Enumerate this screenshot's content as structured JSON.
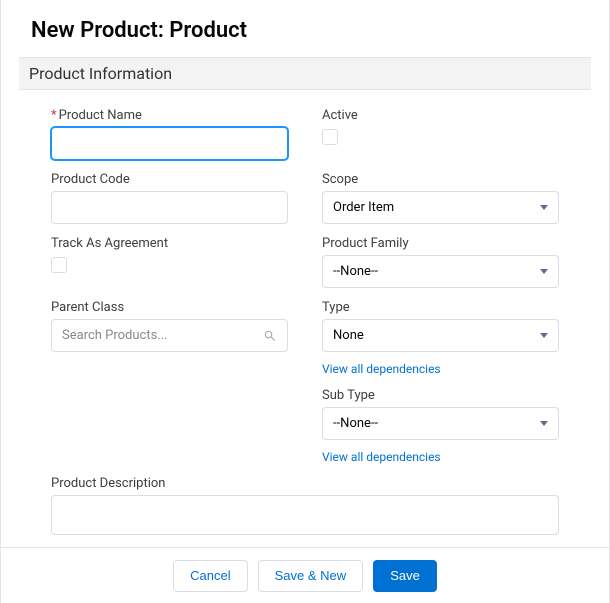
{
  "title": "New Product: Product",
  "section": "Product Information",
  "labels": {
    "productName": "Product Name",
    "active": "Active",
    "productCode": "Product Code",
    "scope": "Scope",
    "trackAsAgreement": "Track As Agreement",
    "productFamily": "Product Family",
    "parentClass": "Parent Class",
    "type": "Type",
    "subType": "Sub Type",
    "productDescription": "Product Description"
  },
  "values": {
    "productName": "",
    "productCode": "",
    "activeChecked": false,
    "scope": "Order Item",
    "trackAsAgreementChecked": false,
    "productFamily": "--None--",
    "parentClassPlaceholder": "Search Products...",
    "type": "None",
    "subType": "--None--",
    "productDescription": ""
  },
  "links": {
    "viewDepsType": "View all dependencies",
    "viewDepsSubType": "View all dependencies"
  },
  "buttons": {
    "cancel": "Cancel",
    "saveNew": "Save & New",
    "save": "Save"
  }
}
